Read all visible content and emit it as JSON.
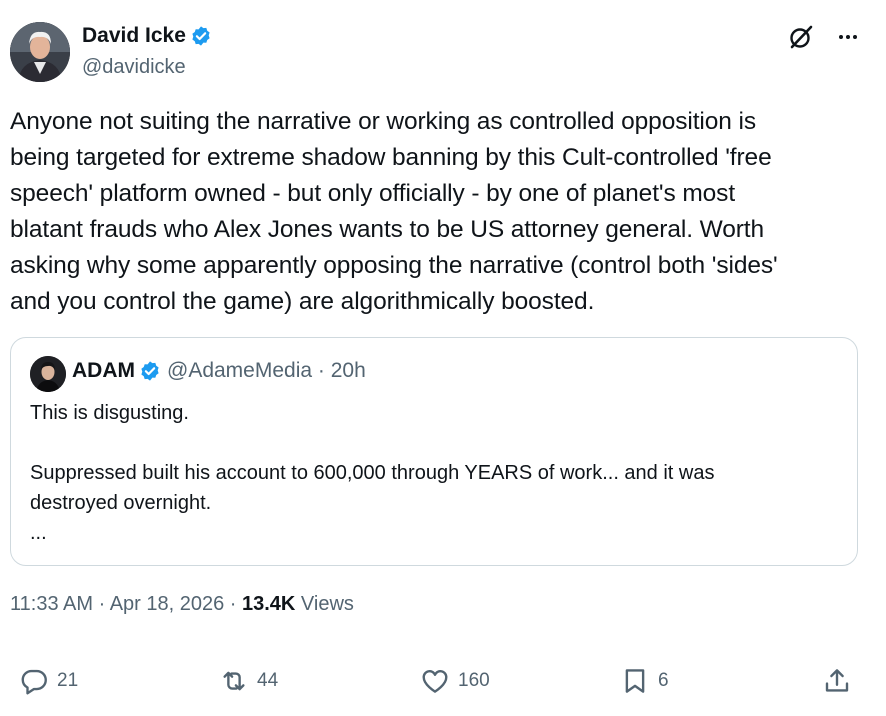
{
  "author": {
    "name": "David Icke",
    "handle": "@davidicke"
  },
  "tweet": {
    "lines": [
      "Anyone not suiting the narrative or working as controlled opposition is",
      "being targeted for extreme shadow banning by this Cult-controlled 'free",
      "speech' platform owned - but only officially - by one of planet's most",
      "blatant frauds who Alex Jones wants to be US attorney general. Worth",
      "asking why some apparently opposing the narrative (control both 'sides'",
      "and you control the game) are algorithmically boosted."
    ]
  },
  "quote": {
    "name": "ADAM",
    "handle_time": "@AdameMedia · 20h",
    "lines": [
      "This is disgusting.",
      "",
      "Suppressed built his account to 600,000 through YEARS of work... and it was",
      "destroyed overnight.",
      "..."
    ]
  },
  "meta": {
    "time_date": "11:33 AM · Apr 18, 2026 · ",
    "views_count": "13.4K",
    "views_label": " Views"
  },
  "actions": {
    "replies": "21",
    "reposts": "44",
    "likes": "160",
    "bookmarks": "6"
  },
  "colors": {
    "verified": "#1d9bf0",
    "secondary_text": "#536471",
    "border": "#cfd9de"
  },
  "icons": [
    "verified-badge-icon",
    "grok-icon",
    "more-icon",
    "reply-icon",
    "repost-icon",
    "like-icon",
    "bookmark-icon",
    "share-icon"
  ]
}
